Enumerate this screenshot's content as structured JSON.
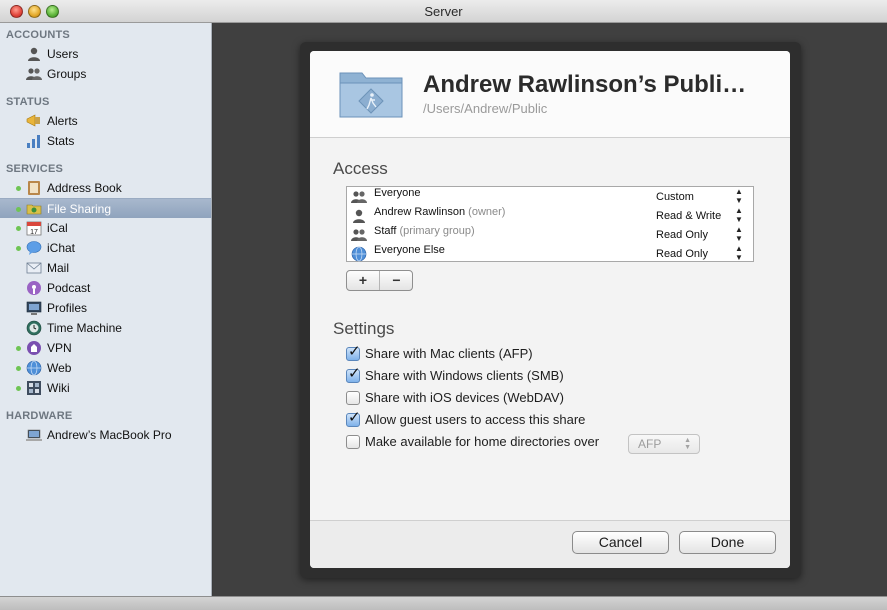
{
  "window": {
    "title": "Server"
  },
  "sidebar": {
    "sections": [
      {
        "header": "ACCOUNTS",
        "items": [
          {
            "label": "Users",
            "icon": "user-icon"
          },
          {
            "label": "Groups",
            "icon": "group-icon"
          }
        ]
      },
      {
        "header": "STATUS",
        "items": [
          {
            "label": "Alerts",
            "icon": "megaphone-icon"
          },
          {
            "label": "Stats",
            "icon": "bar-chart-icon"
          }
        ]
      },
      {
        "header": "SERVICES",
        "items": [
          {
            "label": "Address Book",
            "icon": "address-book-icon",
            "active": true
          },
          {
            "label": "File Sharing",
            "icon": "file-sharing-icon",
            "active": true,
            "selected": true
          },
          {
            "label": "iCal",
            "icon": "calendar-icon",
            "active": true
          },
          {
            "label": "iChat",
            "icon": "chat-icon",
            "active": true
          },
          {
            "label": "Mail",
            "icon": "mail-icon"
          },
          {
            "label": "Podcast",
            "icon": "podcast-icon"
          },
          {
            "label": "Profiles",
            "icon": "profiles-icon"
          },
          {
            "label": "Time Machine",
            "icon": "time-machine-icon"
          },
          {
            "label": "VPN",
            "icon": "vpn-icon",
            "active": true
          },
          {
            "label": "Web",
            "icon": "globe-icon",
            "active": true
          },
          {
            "label": "Wiki",
            "icon": "wiki-icon",
            "active": true
          }
        ]
      },
      {
        "header": "HARDWARE",
        "items": [
          {
            "label": "Andrew’s MacBook Pro",
            "icon": "laptop-icon"
          }
        ]
      }
    ]
  },
  "share": {
    "title": "Andrew Rawlinson’s Publi…",
    "path": "/Users/Andrew/Public"
  },
  "access": {
    "title": "Access",
    "rows": [
      {
        "name": "Everyone",
        "role": "",
        "permission": "Custom",
        "icon": "group-icon"
      },
      {
        "name": "Andrew Rawlinson",
        "role": "(owner)",
        "permission": "Read & Write",
        "icon": "user-icon"
      },
      {
        "name": "Staff",
        "role": "(primary group)",
        "permission": "Read Only",
        "icon": "group-icon"
      },
      {
        "name": "Everyone Else",
        "role": "",
        "permission": "Read Only",
        "icon": "globe-icon"
      }
    ],
    "add_label": "+",
    "remove_label": "−"
  },
  "settings": {
    "title": "Settings",
    "options": [
      {
        "label": "Share with Mac clients (AFP)",
        "checked": true
      },
      {
        "label": "Share with Windows clients (SMB)",
        "checked": true
      },
      {
        "label": "Share with iOS devices (WebDAV)",
        "checked": false
      },
      {
        "label": "Allow guest users to access this share",
        "checked": true
      },
      {
        "label": "Make available for home directories over",
        "checked": false
      }
    ],
    "home_protocol": "AFP"
  },
  "footer": {
    "cancel_label": "Cancel",
    "done_label": "Done"
  },
  "colors": {
    "sidebar_bg": "#e2e8ef",
    "selection": "#8fa3bd",
    "active_dot": "#6fc454",
    "checkbox_checked": "#7fb2ea"
  }
}
